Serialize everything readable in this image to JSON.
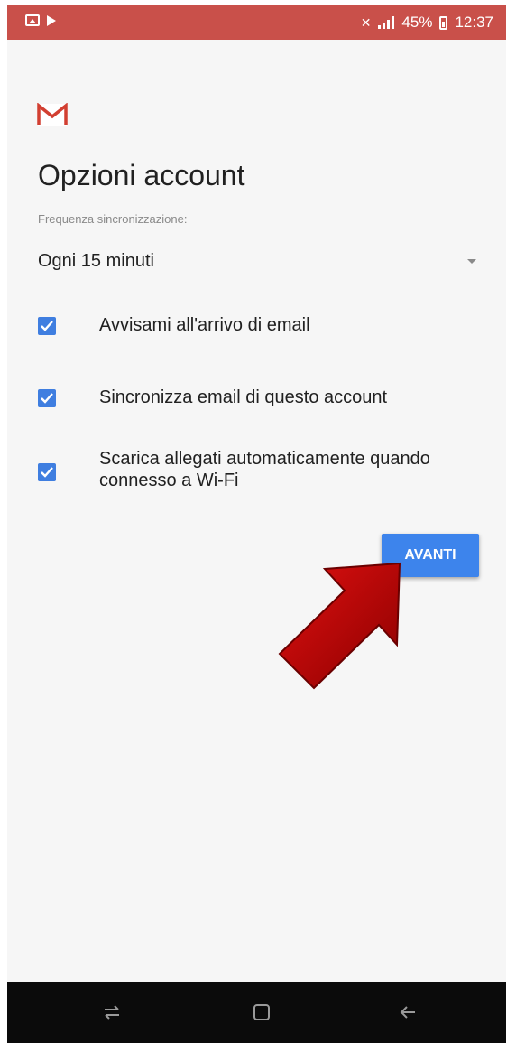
{
  "status_bar": {
    "left_icons": [
      "picture-icon",
      "play-store-icon"
    ],
    "battery": "45%",
    "time": "12:37",
    "icons": [
      "mute-icon",
      "wifi-icon",
      "signal-icon",
      "battery-icon"
    ]
  },
  "header": {
    "logo": "gmail-logo",
    "title": "Opzioni account"
  },
  "sync": {
    "label": "Frequenza sincronizzazione:",
    "value": "Ogni 15 minuti"
  },
  "options": [
    {
      "label": "Avvisami all'arrivo di email",
      "checked": true
    },
    {
      "label": "Sincronizza email di questo account",
      "checked": true
    },
    {
      "label": "Scarica allegati automaticamente quando connesso a Wi-Fi",
      "checked": true
    }
  ],
  "actions": {
    "next_label": "AVANTI"
  },
  "nav_bar": {
    "buttons": [
      "recent-apps-icon",
      "home-icon",
      "back-icon"
    ]
  },
  "colors": {
    "status_bar": "#c9504a",
    "accent": "#3d84ec",
    "checkbox": "#3f7ee0",
    "annotation_arrow": "#b00000"
  }
}
